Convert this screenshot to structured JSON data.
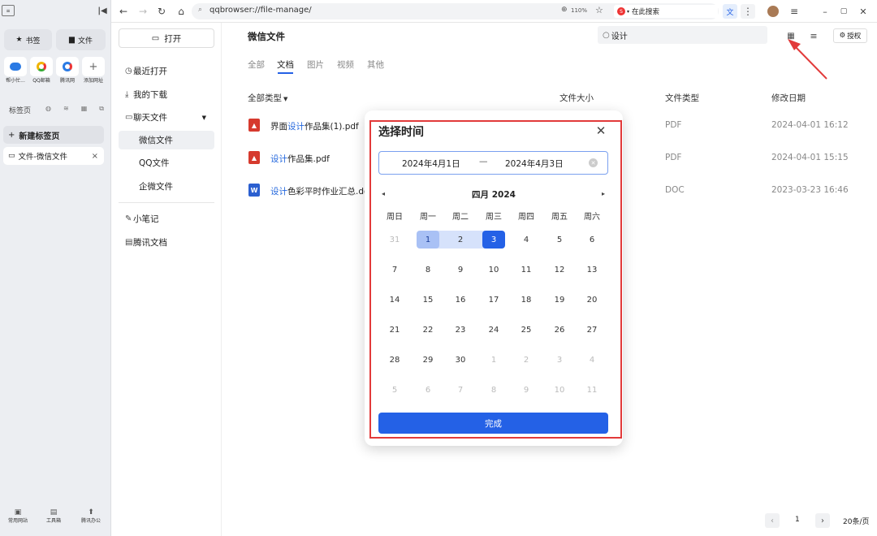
{
  "sidebar": {
    "bookmarks_label": "书签",
    "files_label": "文件",
    "quick": [
      {
        "label": "帮小忙..."
      },
      {
        "label": "QQ邮箱"
      },
      {
        "label": "腾讯网"
      },
      {
        "label": "添加网址"
      }
    ],
    "tabs_title": "标签页",
    "new_tab": "新建标签页",
    "open_tab": "文件-微信文件",
    "bottom": [
      {
        "label": "常用网站"
      },
      {
        "label": "工具箱"
      },
      {
        "label": "腾讯办公"
      }
    ]
  },
  "topbar": {
    "url": "qqbrowser://file-manage/",
    "zoom": "110%",
    "search_engine": "在此搜索"
  },
  "nav": {
    "open": "打开",
    "recent": "最近打开",
    "downloads": "我的下载",
    "chat_files": "聊天文件",
    "wechat": "微信文件",
    "qq": "QQ文件",
    "wecom": "企微文件",
    "notes": "小笔记",
    "tencent_docs": "腾讯文档"
  },
  "main": {
    "title": "微信文件",
    "search_value": "设计",
    "auth": "授权",
    "tabs": [
      "全部",
      "文档",
      "图片",
      "视频",
      "其他"
    ],
    "active_tab": "文档",
    "columns": {
      "type": "全部类型",
      "size": "文件大小",
      "ftype": "文件类型",
      "date": "修改日期"
    },
    "files": [
      {
        "pre": "界面",
        "hl": "设计",
        "post": "作品集(1).pdf",
        "type": "PDF",
        "date": "2024-04-01 16:12"
      },
      {
        "pre": "",
        "hl": "设计",
        "post": "作品集.pdf",
        "type": "PDF",
        "date": "2024-04-01 15:15"
      },
      {
        "pre": "",
        "hl": "设计",
        "post": "色彩平时作业汇总.doc",
        "type": "DOC",
        "date": "2023-03-23 16:46"
      }
    ],
    "pager": {
      "page": "1",
      "per_page": "20条/页"
    }
  },
  "dialog": {
    "title": "选择时间",
    "start": "2024年4月1日",
    "sep": "—",
    "end": "2024年4月3日",
    "month": "四月 2024",
    "weekdays": [
      "周日",
      "周一",
      "周二",
      "周三",
      "周四",
      "周五",
      "周六"
    ],
    "days": [
      "31",
      "1",
      "2",
      "3",
      "4",
      "5",
      "6",
      "7",
      "8",
      "9",
      "10",
      "11",
      "12",
      "13",
      "14",
      "15",
      "16",
      "17",
      "18",
      "19",
      "20",
      "21",
      "22",
      "23",
      "24",
      "25",
      "26",
      "27",
      "28",
      "29",
      "30",
      "1",
      "2",
      "3",
      "4",
      "5",
      "6",
      "7",
      "8",
      "9",
      "10",
      "11"
    ],
    "done": "完成",
    "colors": {
      "accent": "#2461e6",
      "range": "#d6e2fb",
      "range_start": "#a9c1f5",
      "highlight_box": "#e23a3a"
    }
  }
}
